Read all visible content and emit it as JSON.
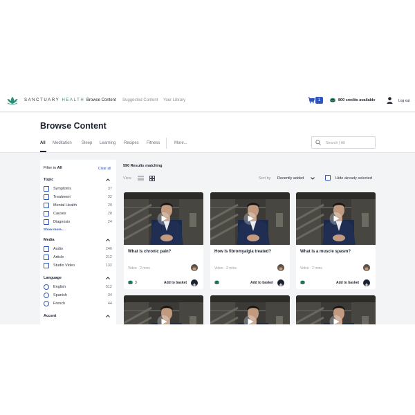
{
  "nav": {
    "brand_left": "SANCTUARY",
    "brand_right": "HEALTH",
    "links": [
      {
        "label": "Browse Content",
        "active": true
      },
      {
        "label": "Suggested Content",
        "active": false
      },
      {
        "label": "Your Library",
        "active": false
      }
    ],
    "cart_count": "1",
    "credits_text": "800 credits available",
    "logout_label": "Log out"
  },
  "header": {
    "title": "Browse Content",
    "tabs": [
      "All",
      "Meditation",
      "Sleep",
      "Learning",
      "Recipes",
      "Fitness"
    ],
    "more_label": "More...",
    "search_placeholder": "Search | All"
  },
  "filter": {
    "prefix": "Filter in",
    "scope": "All",
    "clear_label": "Clear all",
    "show_more_label": "Show more...",
    "sections": [
      {
        "title": "Topic",
        "control": "checkbox",
        "options": [
          {
            "label": "Symptoms",
            "count": "37"
          },
          {
            "label": "Treatment",
            "count": "32"
          },
          {
            "label": "Mental Health",
            "count": "29"
          },
          {
            "label": "Causes",
            "count": "28"
          },
          {
            "label": "Diagnosis",
            "count": "24"
          }
        ]
      },
      {
        "title": "Media",
        "control": "checkbox",
        "options": [
          {
            "label": "Audio",
            "count": "246"
          },
          {
            "label": "Article",
            "count": "212"
          },
          {
            "label": "Studio Video",
            "count": "132"
          }
        ]
      },
      {
        "title": "Language",
        "control": "radio",
        "options": [
          {
            "label": "English",
            "count": "512"
          },
          {
            "label": "Spanish",
            "count": "34"
          },
          {
            "label": "French",
            "count": "44"
          }
        ]
      },
      {
        "title": "Accent",
        "control": "radio",
        "options": []
      }
    ]
  },
  "results": {
    "count_text": "590 Results matching",
    "view_label": "View",
    "sort_label": "Sort by",
    "sort_value": "Recently added",
    "hide_label": "Hide already selected"
  },
  "cards": [
    {
      "title": "What is chronic pain?",
      "meta": "Video · 2 mins",
      "credits": "3",
      "add_label": "Add to basket"
    },
    {
      "title": "How is fibromyalgia treated?",
      "meta": "Video · 2 mins",
      "credits": "",
      "add_label": "Add to basket"
    },
    {
      "title": "What is a muscle spasm?",
      "meta": "Video · 2 mins",
      "credits": "",
      "add_label": "Add to basket"
    },
    {
      "title": "",
      "meta": "",
      "credits": "",
      "add_label": ""
    },
    {
      "title": "",
      "meta": "",
      "credits": "",
      "add_label": ""
    },
    {
      "title": "",
      "meta": "",
      "credits": "",
      "add_label": ""
    }
  ],
  "colors": {
    "accent_blue": "#2f55b8",
    "brand_green": "#2f8f76",
    "text_dark": "#1d2230"
  }
}
